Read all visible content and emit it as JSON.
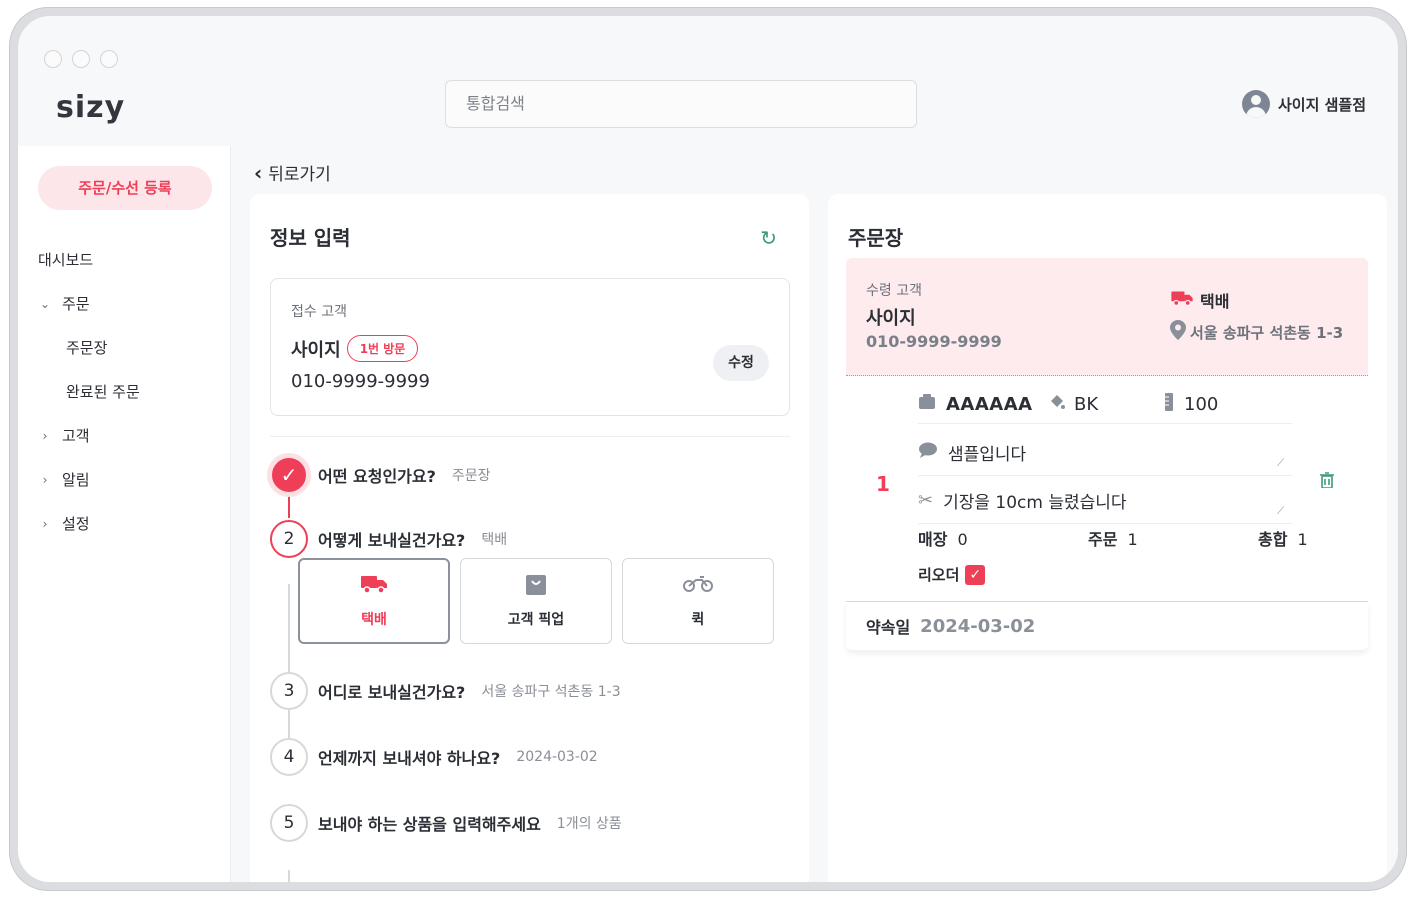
{
  "app": {
    "logo": "sizy",
    "user_name": "사이지 샘플점"
  },
  "search": {
    "placeholder": "통합검색"
  },
  "sidebar": {
    "cta_label": "주문/수선 등록",
    "items": [
      {
        "label": "대시보드"
      },
      {
        "label": "주문",
        "expanded": true
      },
      {
        "label": "주문장"
      },
      {
        "label": "완료된 주문"
      },
      {
        "label": "고객"
      },
      {
        "label": "알림"
      },
      {
        "label": "설정"
      }
    ]
  },
  "back_label": "뒤로가기",
  "form": {
    "title": "정보 입력",
    "customer": {
      "label": "접수 고객",
      "name": "사이지",
      "visit_badge": "1번 방문",
      "phone": "010-9999-9999",
      "edit_label": "수정"
    },
    "steps": [
      {
        "number": "✓",
        "question": "어떤 요청인가요?",
        "answer": "주문장",
        "state": "done"
      },
      {
        "number": "2",
        "question": "어떻게 보내실건가요?",
        "answer": "택배",
        "state": "active"
      },
      {
        "number": "3",
        "question": "어디로 보내실건가요?",
        "answer": "서울 송파구 석촌동 1-3",
        "state": "todo"
      },
      {
        "number": "4",
        "question": "언제까지 보내셔야 하나요?",
        "answer": "2024-03-02",
        "state": "todo"
      },
      {
        "number": "5",
        "question": "보내야 하는 상품을 입력해주세요",
        "answer": "1개의 상품",
        "state": "todo"
      }
    ],
    "delivery_options": [
      {
        "label": "택배",
        "icon": "truck-icon",
        "selected": true
      },
      {
        "label": "고객 픽업",
        "icon": "shopping-bag-icon",
        "selected": false
      },
      {
        "label": "퀵",
        "icon": "motorcycle-icon",
        "selected": false
      }
    ]
  },
  "invoice": {
    "title": "주문장",
    "recipient_label": "수령 고객",
    "recipient_name": "사이지",
    "recipient_phone": "010-9999-9999",
    "ship_method": "택배",
    "address": "서울 송파구 석촌동 1-3",
    "item": {
      "index": "1",
      "code": "AAAAAA",
      "color": "BK",
      "size": "100",
      "memo": "샘플입니다",
      "repair_note": "기장을 10cm 늘렸습니다",
      "store_label": "매장",
      "store_value": "0",
      "order_label": "주문",
      "order_value": "1",
      "total_label": "총합",
      "total_value": "1",
      "reorder_label": "리오더",
      "reorder_checked": true
    },
    "promise_label": "약속일",
    "promise_date": "2024-03-02"
  },
  "colors": {
    "accent": "#ef3e57",
    "accent_light": "#fdebee",
    "teal": "#3a9a7a"
  }
}
